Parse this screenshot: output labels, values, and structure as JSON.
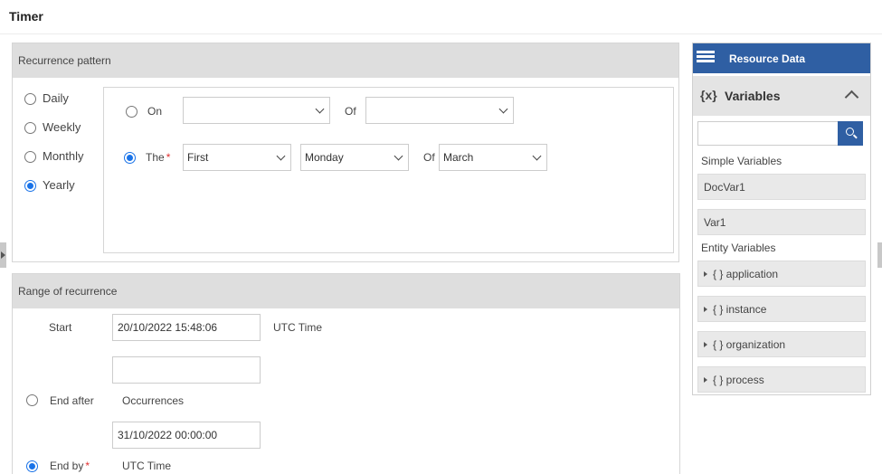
{
  "window": {
    "title": "Timer"
  },
  "recurrence": {
    "header": "Recurrence pattern",
    "options": [
      "Daily",
      "Weekly",
      "Monthly",
      "Yearly"
    ],
    "selected": "Yearly",
    "on_label": "On",
    "on_day_value": "",
    "on_of_label": "Of",
    "on_month_value": "",
    "the_label": "The",
    "required_mark": "*",
    "the_ordinal": "First",
    "the_weekday": "Monday",
    "the_of_label": "Of",
    "the_month": "March"
  },
  "range": {
    "header": "Range of recurrence",
    "start_label": "Start",
    "start_value": "20/10/2022 15:48:06",
    "start_tz": "UTC Time",
    "occurrences_value": "",
    "end_after_label": "End after",
    "occurrences_label": "Occurrences",
    "end_by_value": "31/10/2022 00:00:00",
    "end_by_label": "End by",
    "end_by_tz": "UTC Time",
    "selected_end": "End by"
  },
  "resource_panel": {
    "title": "Resource Data",
    "vars_icon_text": "{x}",
    "vars_title": "Variables",
    "search_value": "",
    "simple_label": "Simple Variables",
    "simple_items": [
      "DocVar1",
      "Var1"
    ],
    "entity_label": "Entity Variables",
    "entity_items": [
      "{ } application",
      "{ } instance",
      "{ } organization",
      "{ } process"
    ]
  },
  "colors": {
    "accent": "#1a73e8",
    "header_blue": "#2f5fa3",
    "required": "#e03030"
  }
}
